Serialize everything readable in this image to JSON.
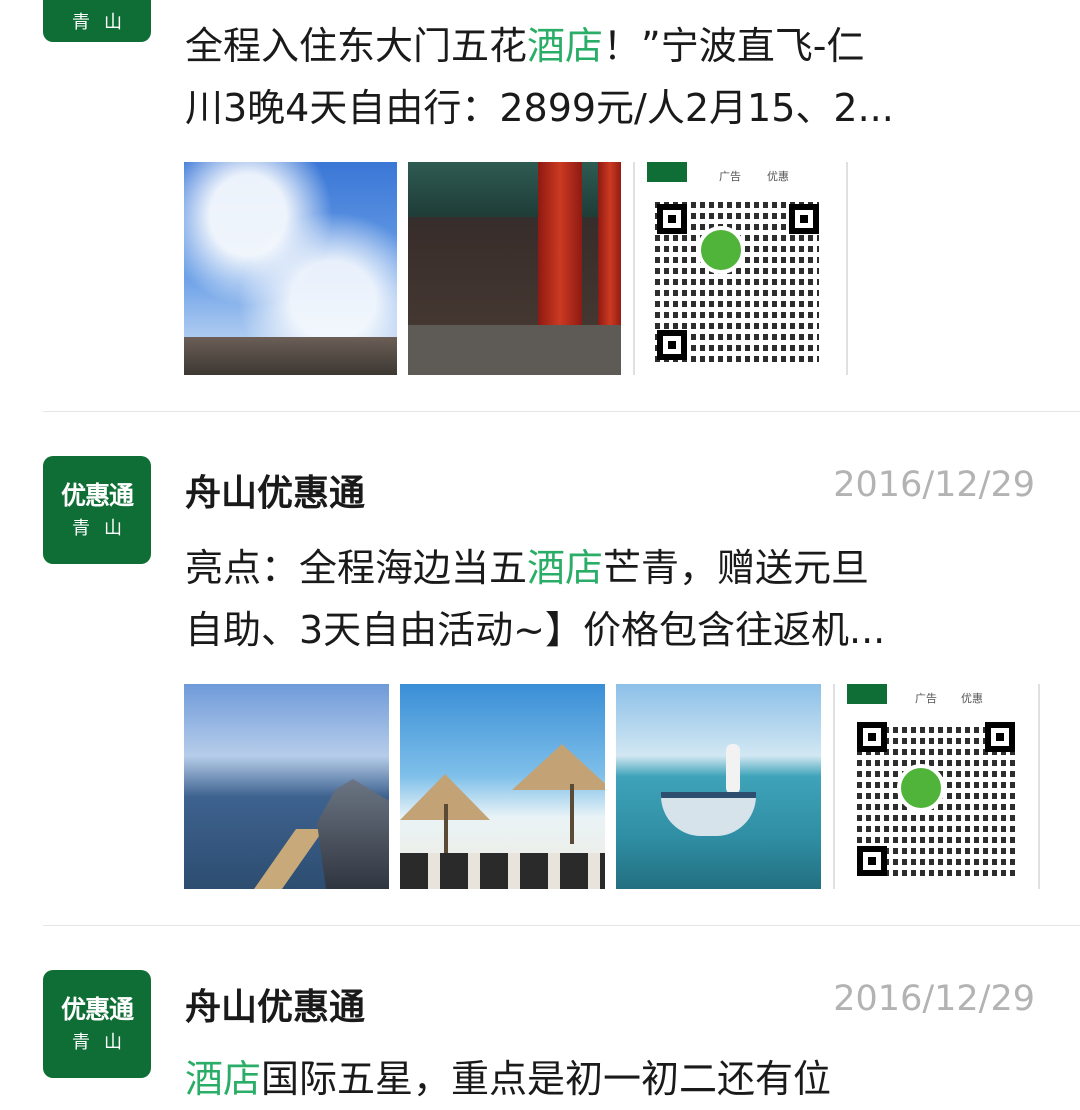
{
  "avatar": {
    "line1": "优惠通",
    "line2": "青山"
  },
  "posts": [
    {
      "name": "",
      "date": "",
      "snippet_line1_before": "全程入住东大门五花",
      "snippet_line1_highlight": "酒店",
      "snippet_line1_after": "！”宁波直飞-仁",
      "snippet_line2": "川3晚4天自由行：2899元/人2月15、2..."
    },
    {
      "name": "舟山优惠通",
      "date": "2016/12/29",
      "snippet_line1_before": "亮点：全程海边当五",
      "snippet_line1_highlight": "酒店",
      "snippet_line1_after": "芒青，赠送元旦",
      "snippet_line2": "自助、3天自由活动~】价格包含往返机..."
    },
    {
      "name": "舟山优惠通",
      "date": "2016/12/29",
      "snippet_line1_highlight": "酒店",
      "snippet_line1_after": "国际五星，重点是初一初二还有位"
    }
  ],
  "qr_tags": {
    "left": "广告",
    "right": "优惠"
  },
  "colors": {
    "brand_green": "#0f6e35",
    "highlight": "#2aae67",
    "date_gray": "#b3b3b3"
  }
}
